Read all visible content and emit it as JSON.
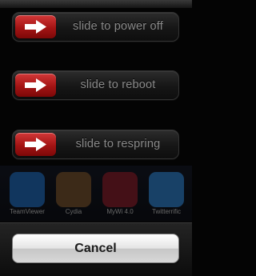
{
  "sliders": [
    {
      "label": "slide to power off"
    },
    {
      "label": "slide to reboot"
    },
    {
      "label": "slide to respring"
    }
  ],
  "apps": [
    {
      "name": "TeamViewer",
      "icon": "teamviewer-icon",
      "color": "#1d5fa8"
    },
    {
      "name": "Cydia",
      "icon": "cydia-icon",
      "color": "#6b4a2a"
    },
    {
      "name": "MyWi 4.0",
      "icon": "mywi-icon",
      "color": "#7a1a28"
    },
    {
      "name": "Twitterrific",
      "icon": "twitterrific-icon",
      "color": "#2a73b8"
    }
  ],
  "cancel": {
    "label": "Cancel"
  },
  "colors": {
    "knob": "#b81d1d",
    "track": "#1a1a1a",
    "label": "#8a8a8a"
  }
}
